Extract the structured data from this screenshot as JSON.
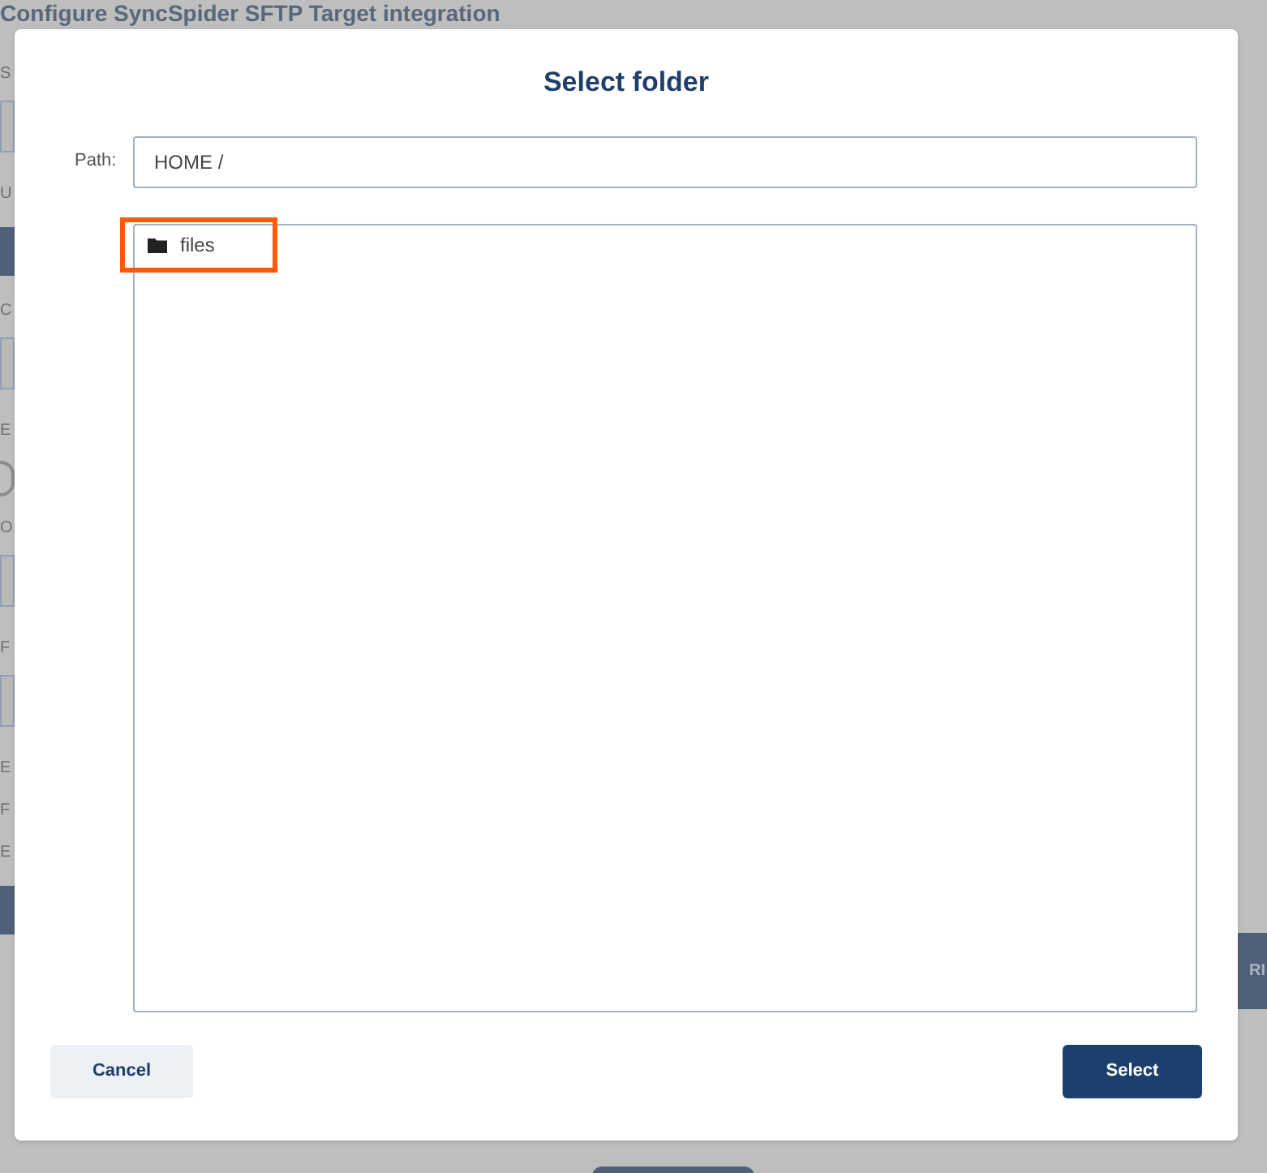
{
  "background": {
    "title": "Configure SyncSpider SFTP Target integration",
    "strip": [
      {
        "kind": "label",
        "text": "S"
      },
      {
        "kind": "field"
      },
      {
        "kind": "label",
        "text": "U"
      },
      {
        "kind": "bar"
      },
      {
        "kind": "label",
        "text": "C"
      },
      {
        "kind": "field"
      },
      {
        "kind": "label",
        "text": "E"
      },
      {
        "kind": "toggle",
        "on": false
      },
      {
        "kind": "label",
        "text": "O"
      },
      {
        "kind": "field"
      },
      {
        "kind": "label",
        "text": "F"
      },
      {
        "kind": "field"
      },
      {
        "kind": "label",
        "text": "E"
      },
      {
        "kind": "label",
        "text": "F"
      },
      {
        "kind": "label",
        "text": "E"
      },
      {
        "kind": "bar"
      }
    ],
    "right_button": "RI"
  },
  "dialog": {
    "title": "Select folder",
    "path_label": "Path:",
    "path_value": "HOME /",
    "folders": [
      {
        "name": "files",
        "selected": true
      }
    ],
    "buttons": [
      {
        "label": "Cancel",
        "kind": "secondary"
      },
      {
        "label": "Select",
        "kind": "primary"
      }
    ]
  }
}
